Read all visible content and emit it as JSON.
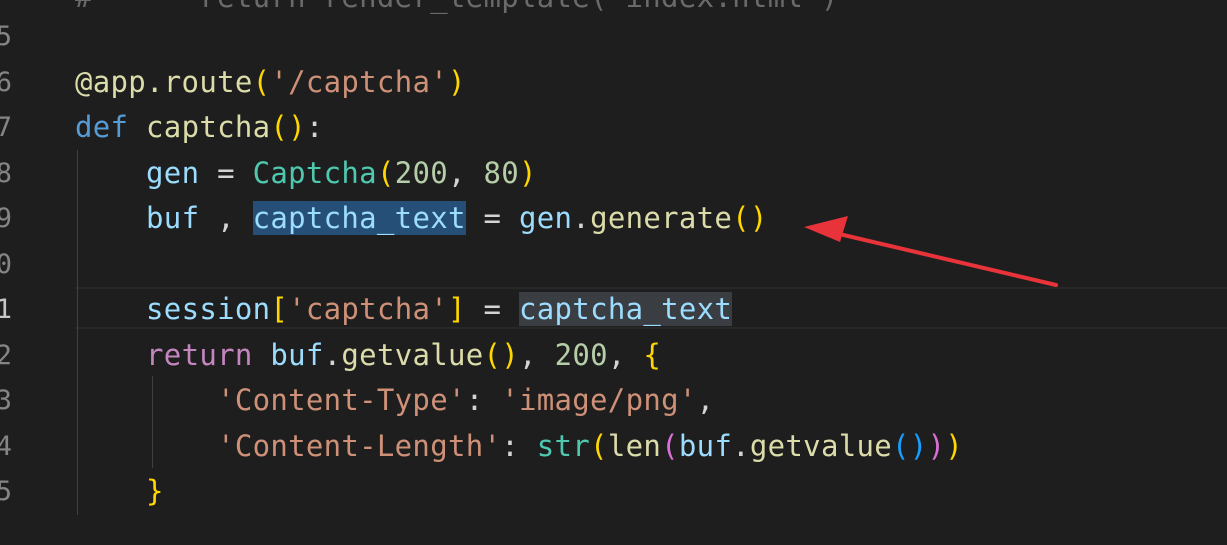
{
  "editor": {
    "line_numbers": [
      "5",
      "6",
      "7",
      "8",
      "9",
      "0",
      "1",
      "2",
      "3",
      "4",
      "5"
    ],
    "active_line_number": "1",
    "top_partial_line": "#      return render_template('index.html')",
    "lines": [
      {
        "tokens": []
      },
      {
        "tokens": [
          {
            "t": "@app.route",
            "c": "dec"
          },
          {
            "t": "(",
            "c": "br1"
          },
          {
            "t": "'/captcha'",
            "c": "str"
          },
          {
            "t": ")",
            "c": "br1"
          }
        ]
      },
      {
        "tokens": [
          {
            "t": "def",
            "c": "kw"
          },
          {
            "t": " ",
            "c": "op"
          },
          {
            "t": "captcha",
            "c": "fn"
          },
          {
            "t": "()",
            "c": "br1"
          },
          {
            "t": ":",
            "c": "op"
          }
        ]
      },
      {
        "tokens": [
          {
            "t": "    ",
            "c": "op"
          },
          {
            "t": "gen",
            "c": "var"
          },
          {
            "t": " = ",
            "c": "op"
          },
          {
            "t": "Captcha",
            "c": "cls"
          },
          {
            "t": "(",
            "c": "br1"
          },
          {
            "t": "200",
            "c": "num"
          },
          {
            "t": ", ",
            "c": "op"
          },
          {
            "t": "80",
            "c": "num"
          },
          {
            "t": ")",
            "c": "br1"
          }
        ]
      },
      {
        "tokens": [
          {
            "t": "    ",
            "c": "op"
          },
          {
            "t": "buf",
            "c": "var"
          },
          {
            "t": " , ",
            "c": "op"
          },
          {
            "t": "captcha_text",
            "c": "var hl-sel"
          },
          {
            "t": " = ",
            "c": "op"
          },
          {
            "t": "gen",
            "c": "var"
          },
          {
            "t": ".",
            "c": "op"
          },
          {
            "t": "generate",
            "c": "fn"
          },
          {
            "t": "()",
            "c": "br1"
          }
        ]
      },
      {
        "tokens": []
      },
      {
        "tokens": [
          {
            "t": "    ",
            "c": "op"
          },
          {
            "t": "session",
            "c": "var"
          },
          {
            "t": "[",
            "c": "br1"
          },
          {
            "t": "'captcha'",
            "c": "str"
          },
          {
            "t": "]",
            "c": "br1"
          },
          {
            "t": " = ",
            "c": "op"
          },
          {
            "t": "captcha_text",
            "c": "var hl-word"
          }
        ]
      },
      {
        "tokens": [
          {
            "t": "    ",
            "c": "op"
          },
          {
            "t": "return",
            "c": "ctl"
          },
          {
            "t": " ",
            "c": "op"
          },
          {
            "t": "buf",
            "c": "var"
          },
          {
            "t": ".",
            "c": "op"
          },
          {
            "t": "getvalue",
            "c": "fn"
          },
          {
            "t": "()",
            "c": "br1"
          },
          {
            "t": ", ",
            "c": "op"
          },
          {
            "t": "200",
            "c": "num"
          },
          {
            "t": ", ",
            "c": "op"
          },
          {
            "t": "{",
            "c": "br1"
          }
        ]
      },
      {
        "tokens": [
          {
            "t": "        ",
            "c": "op"
          },
          {
            "t": "'Content-Type'",
            "c": "str"
          },
          {
            "t": ": ",
            "c": "op"
          },
          {
            "t": "'image/png'",
            "c": "str"
          },
          {
            "t": ",",
            "c": "op"
          }
        ]
      },
      {
        "tokens": [
          {
            "t": "        ",
            "c": "op"
          },
          {
            "t": "'Content-Length'",
            "c": "str"
          },
          {
            "t": ": ",
            "c": "op"
          },
          {
            "t": "str",
            "c": "cls"
          },
          {
            "t": "(",
            "c": "br1"
          },
          {
            "t": "len",
            "c": "fn"
          },
          {
            "t": "(",
            "c": "br2"
          },
          {
            "t": "buf",
            "c": "var"
          },
          {
            "t": ".",
            "c": "op"
          },
          {
            "t": "getvalue",
            "c": "fn"
          },
          {
            "t": "(",
            "c": "br3"
          },
          {
            "t": ")",
            "c": "br3"
          },
          {
            "t": ")",
            "c": "br2"
          },
          {
            "t": ")",
            "c": "br1"
          }
        ]
      },
      {
        "tokens": [
          {
            "t": "    ",
            "c": "op"
          },
          {
            "t": "}",
            "c": "br1"
          }
        ]
      }
    ]
  },
  "annotation": {
    "arrow_color": "#e8333a"
  },
  "colors": {
    "background": "#1e1e1e",
    "selection": "#264f78",
    "word_highlight": "#3a3d41"
  }
}
